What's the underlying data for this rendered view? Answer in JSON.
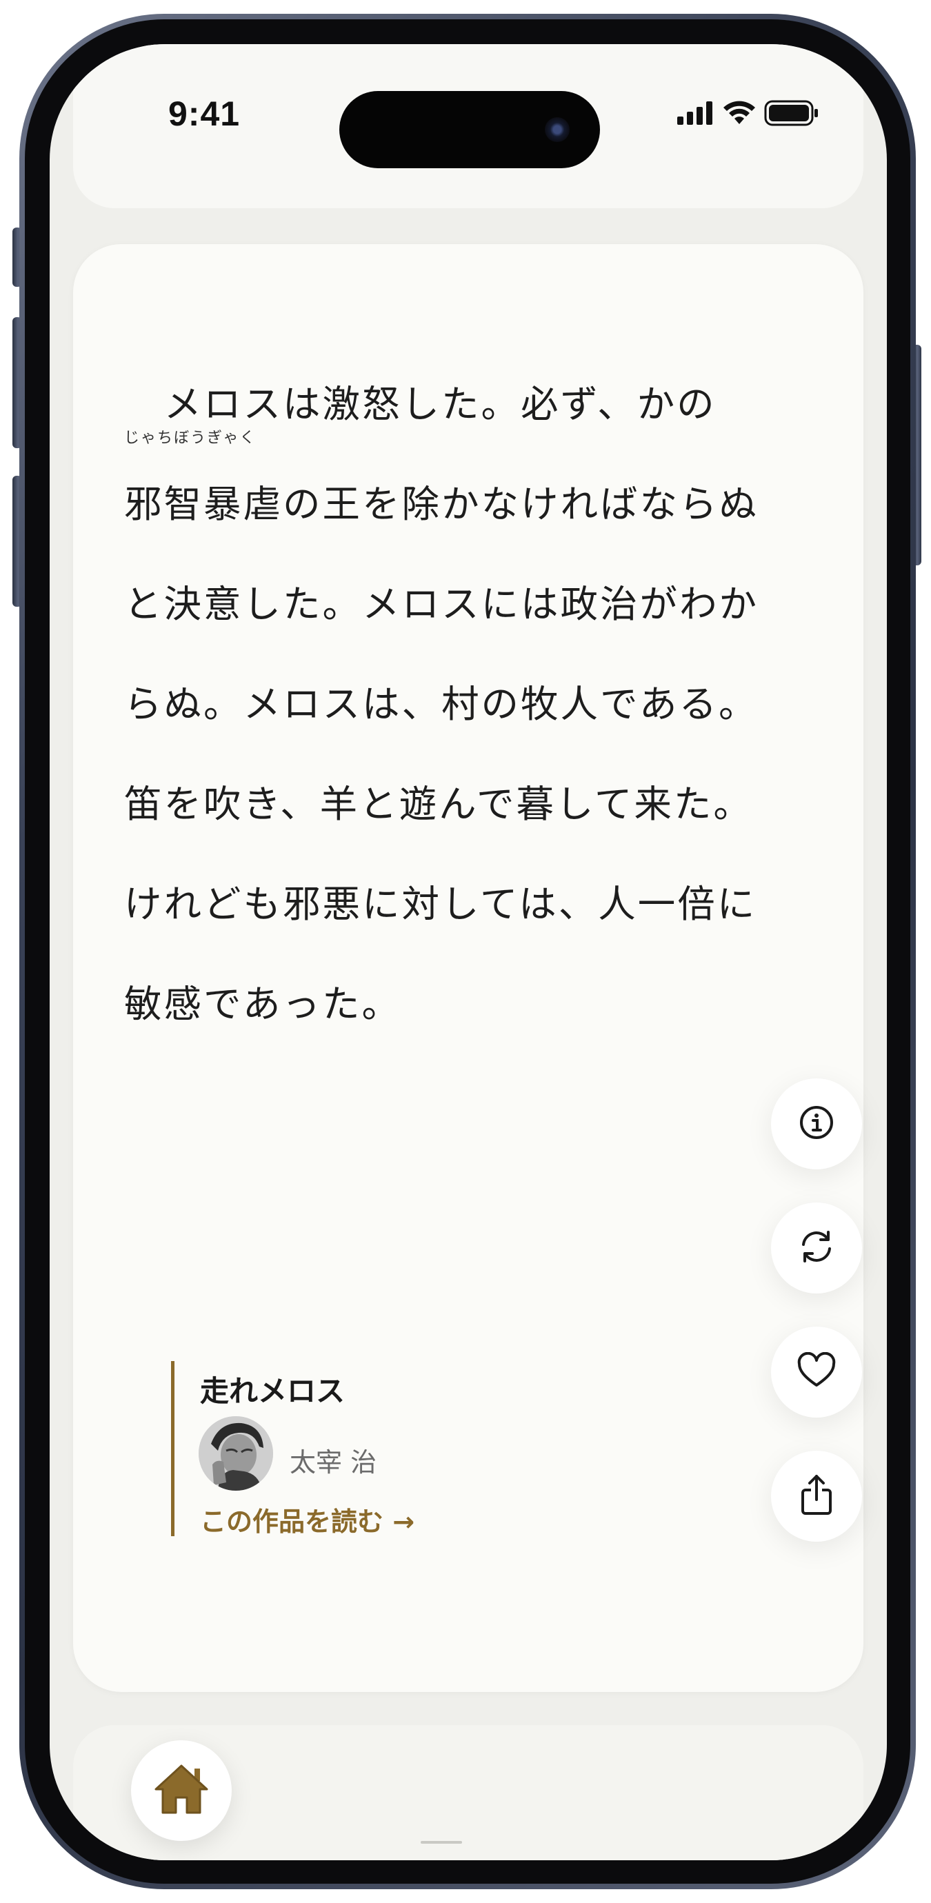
{
  "status_bar": {
    "time": "9:41",
    "icons": [
      "signal-icon",
      "wifi-icon",
      "battery-icon"
    ]
  },
  "passage": {
    "ruby": "じゃちぼうぎゃく",
    "lines": [
      "　メロスは激怒した。必ず、かの",
      "邪智暴虐の王を除かなければならぬ",
      "と決意した。メロスには政治がわか",
      "らぬ。メロスは、村の牧人である。",
      "笛を吹き、羊と遊んで暮して来た。",
      "けれども邪悪に対しては、人一倍に",
      "敏感であった。"
    ]
  },
  "work": {
    "title": "走れメロス",
    "author": "太宰 治",
    "read_link": "この作品を読む →"
  },
  "actions": [
    {
      "name": "info-button",
      "icon": "info-icon"
    },
    {
      "name": "refresh-button",
      "icon": "refresh-icon"
    },
    {
      "name": "favorite-button",
      "icon": "heart-icon"
    },
    {
      "name": "share-button",
      "icon": "share-icon"
    }
  ],
  "colors": {
    "accent": "#8b6a2b",
    "card_background": "#fbfbf8",
    "screen_background": "#efefeb",
    "text": "#1d1d1d"
  }
}
